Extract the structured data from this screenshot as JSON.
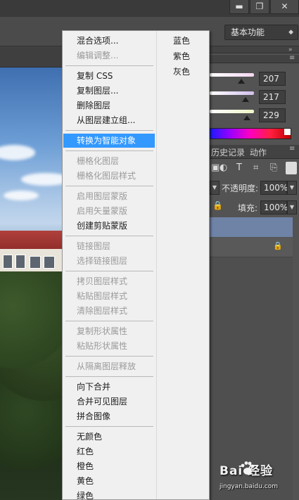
{
  "window": {
    "buttons": [
      "▬",
      "❐",
      "✕"
    ]
  },
  "workspace": {
    "label": "基本功能"
  },
  "color_panel": {
    "values": [
      "207",
      "217",
      "229"
    ],
    "track_colors": [
      "#f5d6f2",
      "#d2bfee",
      "#eef5c6"
    ]
  },
  "history_tabs": [
    "历史记录",
    "动作"
  ],
  "layers_panel": {
    "opacity_label": "不透明度:",
    "opacity_value": "100%",
    "fill_label": "填充:",
    "fill_value": "100%",
    "toolbar_icons": [
      "▣",
      "◐",
      "T",
      "⌗",
      "⎘"
    ],
    "lock_icon": "🔒"
  },
  "context_menu": {
    "items": [
      {
        "label": "混合选项...",
        "enabled": true
      },
      {
        "label": "编辑调整...",
        "enabled": false
      },
      {
        "label": "复制 CSS",
        "enabled": true
      },
      {
        "label": "复制图层...",
        "enabled": true
      },
      {
        "label": "删除图层",
        "enabled": true
      },
      {
        "label": "从图层建立组...",
        "enabled": true
      },
      {
        "label": "转换为智能对象",
        "enabled": true,
        "highlighted": true
      },
      {
        "label": "栅格化图层",
        "enabled": false
      },
      {
        "label": "栅格化图层样式",
        "enabled": false
      },
      {
        "label": "启用图层蒙版",
        "enabled": false
      },
      {
        "label": "启用矢量蒙版",
        "enabled": false
      },
      {
        "label": "创建剪贴蒙版",
        "enabled": true
      },
      {
        "label": "链接图层",
        "enabled": false
      },
      {
        "label": "选择链接图层",
        "enabled": false
      },
      {
        "label": "拷贝图层样式",
        "enabled": false
      },
      {
        "label": "粘贴图层样式",
        "enabled": false
      },
      {
        "label": "清除图层样式",
        "enabled": false
      },
      {
        "label": "复制形状属性",
        "enabled": false
      },
      {
        "label": "粘贴形状属性",
        "enabled": false
      },
      {
        "label": "从隔离图层释放",
        "enabled": false
      },
      {
        "label": "向下合并",
        "enabled": true
      },
      {
        "label": "合并可见图层",
        "enabled": true
      },
      {
        "label": "拼合图像",
        "enabled": true
      },
      {
        "label": "无颜色",
        "enabled": true
      },
      {
        "label": "红色",
        "enabled": true
      },
      {
        "label": "橙色",
        "enabled": true
      },
      {
        "label": "黄色",
        "enabled": true
      },
      {
        "label": "绿色",
        "enabled": true
      }
    ],
    "color_items": [
      "蓝色",
      "紫色",
      "灰色"
    ],
    "highlight_color": "#3399ff"
  },
  "watermark": {
    "logo": "Bai 经验",
    "url": "jingyan.baidu.com"
  }
}
